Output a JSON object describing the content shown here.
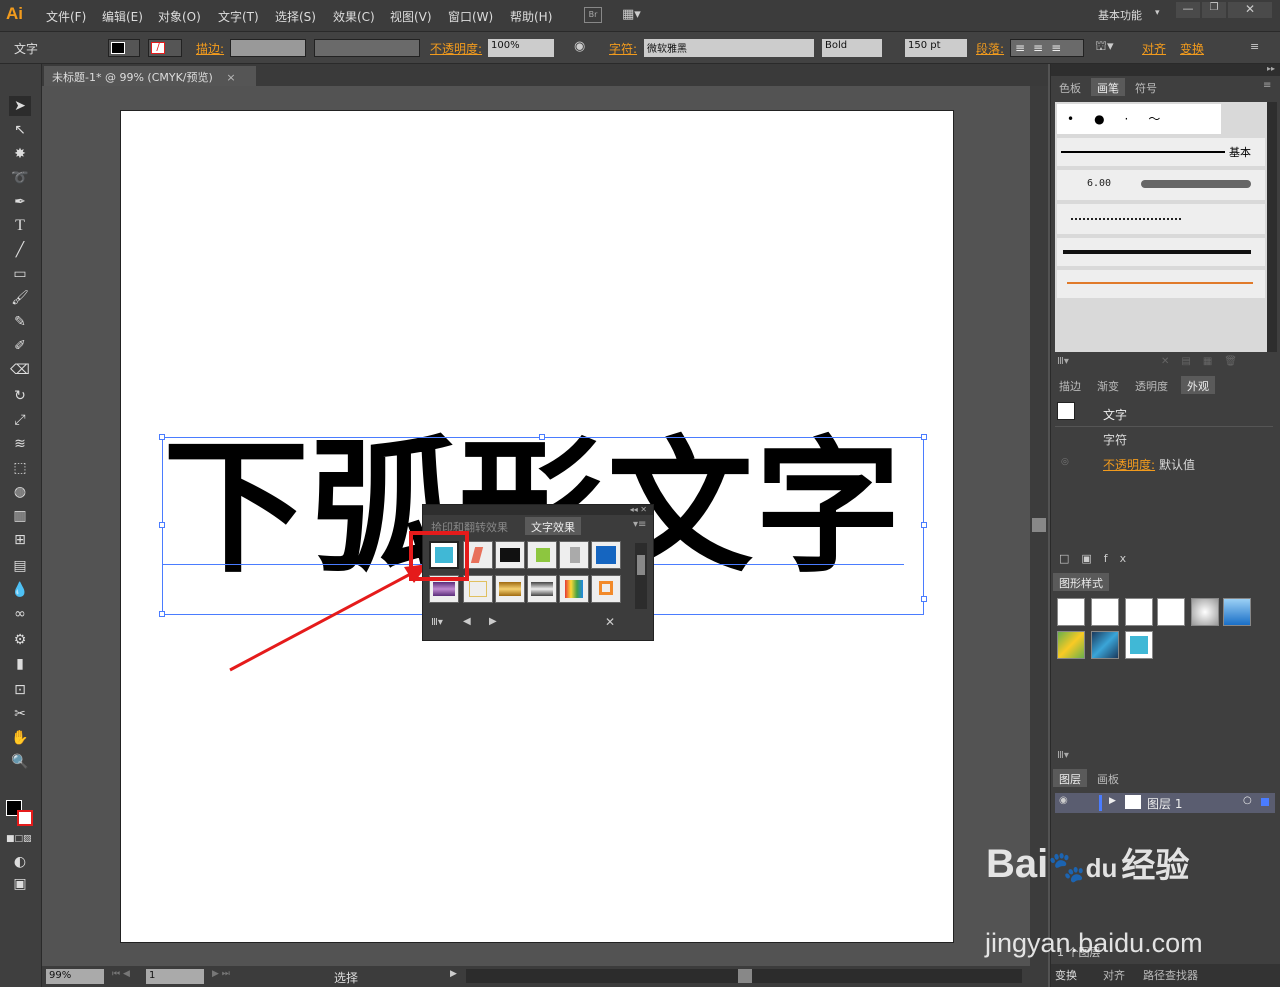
{
  "app": {
    "logo": "Ai",
    "workspace": "基本功能"
  },
  "menu": [
    "文件(F)",
    "编辑(E)",
    "对象(O)",
    "文字(T)",
    "选择(S)",
    "效果(C)",
    "视图(V)",
    "窗口(W)",
    "帮助(H)"
  ],
  "bridge": "Br",
  "controlbar": {
    "mode_label": "文字",
    "stroke_label": "描边:",
    "opacity_label": "不透明度:",
    "opacity_value": "100%",
    "char_label": "字符:",
    "font_name": "微软雅黑",
    "font_style": "Bold",
    "font_size": "150 pt",
    "para_label": "段落:",
    "align_label": "对齐",
    "transform_label": "变换"
  },
  "document": {
    "tab_title": "未标题-1* @ 99% (CMYK/预览)",
    "close_glyph": "×"
  },
  "canvas": {
    "text": "下弧形文字"
  },
  "float_panel": {
    "tabs": [
      "拾印和翻转效果",
      "文字效果"
    ],
    "active_tab": 1
  },
  "right_panel": {
    "top_tabs": [
      "色板",
      "画笔",
      "符号"
    ],
    "brush_basic": "基本",
    "brush_size": "6.00",
    "appearance_tabs": [
      "描边",
      "渐变",
      "透明度",
      "外观"
    ],
    "appearance": {
      "title": "文字",
      "char_row": "字符",
      "opacity_label": "不透明度:",
      "opacity_value": "默认值"
    },
    "graphic_styles_tab": "图形样式",
    "layers_tabs": [
      "图层",
      "画板"
    ],
    "layer_name": "图层 1",
    "layer_count": "1 个图层",
    "bottom_tabs": [
      "变换",
      "对齐",
      "路径查找器"
    ]
  },
  "status": {
    "zoom": "99%",
    "artboard_num": "1",
    "tool": "选择"
  },
  "watermark": {
    "brand": "Bai",
    "brand2": "du",
    "jy": "经验",
    "url": "jingyan.baidu.com"
  },
  "colors": {
    "accent_orange": "#f29b1d",
    "selection_blue": "#4a7cff",
    "highlight_red": "#e51b1b",
    "effect_cyan": "#40b8d6"
  }
}
